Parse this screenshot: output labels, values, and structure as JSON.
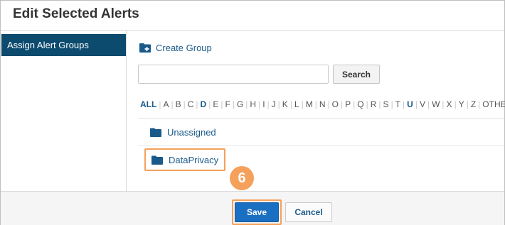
{
  "dialog": {
    "title": "Edit Selected Alerts"
  },
  "sidebar": {
    "items": [
      {
        "label": "Assign Alert Groups",
        "active": true
      }
    ]
  },
  "main": {
    "create_group_label": "Create Group",
    "search": {
      "value": "",
      "placeholder": "",
      "button_label": "Search"
    },
    "alphabet": [
      {
        "label": "ALL",
        "bold": true
      },
      {
        "label": "A",
        "bold": false
      },
      {
        "label": "B",
        "bold": false
      },
      {
        "label": "C",
        "bold": false
      },
      {
        "label": "D",
        "bold": true
      },
      {
        "label": "E",
        "bold": false
      },
      {
        "label": "F",
        "bold": false
      },
      {
        "label": "G",
        "bold": false
      },
      {
        "label": "H",
        "bold": false
      },
      {
        "label": "I",
        "bold": false
      },
      {
        "label": "J",
        "bold": false
      },
      {
        "label": "K",
        "bold": false
      },
      {
        "label": "L",
        "bold": false
      },
      {
        "label": "M",
        "bold": false
      },
      {
        "label": "N",
        "bold": false
      },
      {
        "label": "O",
        "bold": false
      },
      {
        "label": "P",
        "bold": false
      },
      {
        "label": "Q",
        "bold": false
      },
      {
        "label": "R",
        "bold": false
      },
      {
        "label": "S",
        "bold": false
      },
      {
        "label": "T",
        "bold": false
      },
      {
        "label": "U",
        "bold": true
      },
      {
        "label": "V",
        "bold": false
      },
      {
        "label": "W",
        "bold": false
      },
      {
        "label": "X",
        "bold": false
      },
      {
        "label": "Y",
        "bold": false
      },
      {
        "label": "Z",
        "bold": false
      },
      {
        "label": "OTHERS",
        "bold": false
      }
    ],
    "groups": [
      {
        "label": "Unassigned",
        "icon": "folder-icon"
      },
      {
        "label": "DataPrivacy",
        "icon": "folder-icon",
        "highlighted": true
      }
    ]
  },
  "footer": {
    "save_label": "Save",
    "cancel_label": "Cancel"
  },
  "callout": {
    "step": "6"
  },
  "colors": {
    "accent": "#1b6fc2",
    "sidebar_active": "#0c4a6e",
    "highlight": "#f5a15b",
    "link": "#1a5a8a"
  }
}
